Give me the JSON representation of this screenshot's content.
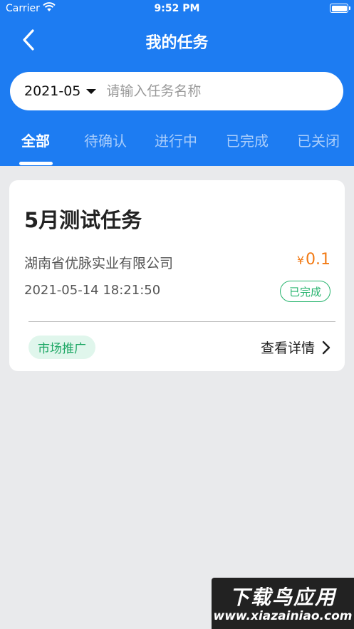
{
  "status_bar": {
    "carrier": "Carrier",
    "time": "9:52 PM",
    "battery": 1.0
  },
  "nav": {
    "title": "我的任务"
  },
  "search": {
    "date": "2021-05",
    "placeholder": "请输入任务名称",
    "value": ""
  },
  "tabs": [
    {
      "label": "全部",
      "active": true
    },
    {
      "label": "待确认",
      "active": false
    },
    {
      "label": "进行中",
      "active": false
    },
    {
      "label": "已完成",
      "active": false
    },
    {
      "label": "已关闭",
      "active": false
    }
  ],
  "tasks": [
    {
      "title": "5月测试任务",
      "company": "湖南省优脉实业有限公司",
      "currency": "¥",
      "amount": "0.1",
      "datetime": "2021-05-14 18:21:50",
      "status": "已完成",
      "category": "市场推广",
      "details_label": "查看详情"
    }
  ],
  "watermark": {
    "name": "下载鸟应用",
    "url": "www.xiazainiao.com"
  },
  "colors": {
    "primary": "#1d7cf2",
    "tab_inactive": "#a9cdfb",
    "price": "#f27a14",
    "status_green": "#27b46e",
    "tag_bg": "#e0f6ec",
    "page_bg": "#e9eaec"
  }
}
